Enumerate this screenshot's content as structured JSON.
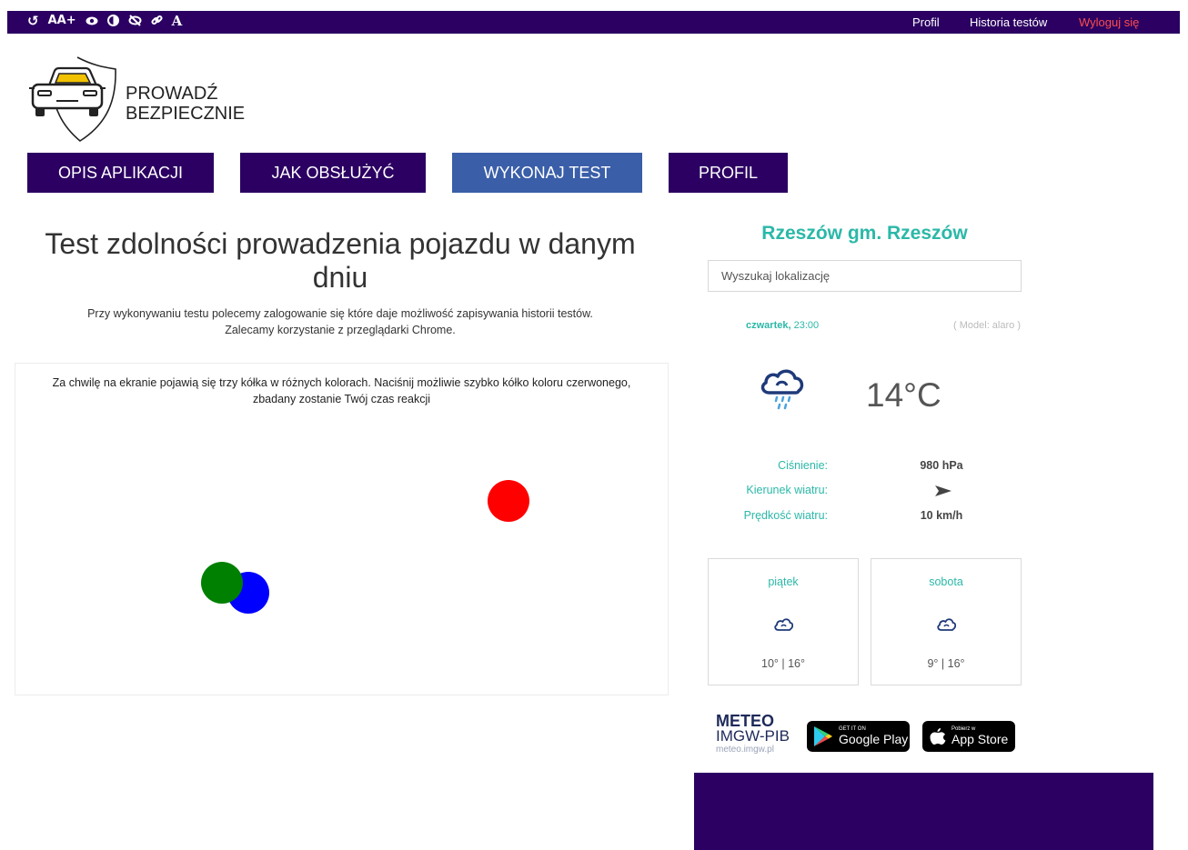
{
  "topbar": {
    "a11y_icons": [
      "reset-icon",
      "font-size-icon",
      "visibility-icon",
      "contrast-icon",
      "hide-icon",
      "link-icon",
      "font-icon"
    ],
    "a11y_font_label": "AA+",
    "a11y_letter": "A",
    "links": {
      "profile": "Profil",
      "history": "Historia testów",
      "logout": "Wyloguj się"
    }
  },
  "logo": {
    "line1": "PROWADŹ",
    "line2": "BEZPIECZNIE"
  },
  "nav": {
    "items": [
      {
        "label": "OPIS APLIKACJI"
      },
      {
        "label": "JAK OBSŁUŻYĆ"
      },
      {
        "label": "WYKONAJ TEST",
        "active": true
      },
      {
        "label": "PROFIL"
      }
    ]
  },
  "test": {
    "title": "Test zdolności prowadzenia pojazdu w danym dniu",
    "subtitle_line1": "Przy wykonywaniu testu polecemy zalogowanie się które daje możliwość zapisywania historii testów.",
    "subtitle_line2": "Zalecamy korzystanie z przeglądarki Chrome.",
    "instruction_line1": "Za chwilę na ekranie pojawią się trzy kółka w różnych kolorach. Naciśnij możliwie szybko kółko koloru czerwonego,",
    "instruction_line2": "zbadany zostanie Twój czas reakcji",
    "circles": [
      {
        "color": "#ff0000",
        "name": "red-circle"
      },
      {
        "color": "#0000ff",
        "name": "blue-circle"
      },
      {
        "color": "#008000",
        "name": "green-circle"
      }
    ]
  },
  "weather": {
    "city": "Rzeszów gm. Rzeszów",
    "search_placeholder": "Wyszukaj lokalizację",
    "day": "czwartek,",
    "time": "23:00",
    "model": "( Model: alaro )",
    "icon": "cloud-rain-icon",
    "temperature": "14°C",
    "pressure_label": "Ciśnienie:",
    "pressure_value": "980 hPa",
    "wind_dir_label": "Kierunek wiatru:",
    "wind_dir_icon": "wind-arrow-icon",
    "wind_speed_label": "Prędkość wiatru:",
    "wind_speed_value": "10 km/h",
    "forecast": [
      {
        "day": "piątek",
        "icon": "cloud-icon",
        "temps": "10° | 16°"
      },
      {
        "day": "sobota",
        "icon": "cloud-icon",
        "temps": "9° | 16°"
      }
    ],
    "meteo": {
      "title": "METEO",
      "subtitle": "IMGW-PIB",
      "url": "meteo.imgw.pl"
    },
    "google_play": {
      "small": "GET IT ON",
      "big": "Google Play"
    },
    "app_store": {
      "small": "Pobierz w",
      "big": "App Store"
    }
  },
  "colors": {
    "brand_purple": "#2b0062",
    "active_nav": "#3a5ea8",
    "teal": "#2bb8a8",
    "logout_red": "#ff4d4d"
  }
}
